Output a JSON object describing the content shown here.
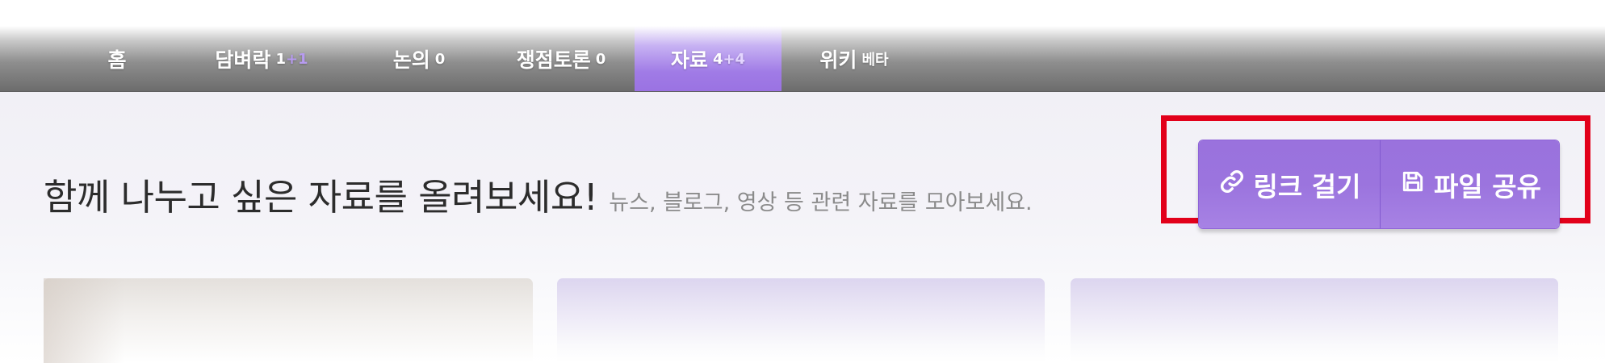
{
  "nav": {
    "tabs": [
      {
        "label": "홈",
        "count": "",
        "plus": "",
        "extra": ""
      },
      {
        "label": "담벼락",
        "count": "1",
        "plus": "+1",
        "extra": ""
      },
      {
        "label": "논의",
        "count": "0",
        "plus": "",
        "extra": ""
      },
      {
        "label": "쟁점토론",
        "count": "0",
        "plus": "",
        "extra": ""
      },
      {
        "label": "자료",
        "count": "4",
        "plus": "+4",
        "extra": ""
      },
      {
        "label": "위키",
        "count": "",
        "plus": "",
        "extra": "베타"
      }
    ],
    "active_tab": "자료"
  },
  "main": {
    "headline": "함께 나누고 싶은 자료를 올려보세요!",
    "subline": "뉴스, 블로그, 영상 등 관련 자료를 모아보세요."
  },
  "actions": {
    "link_label": "링크 걸기",
    "link_icon": "link-icon",
    "file_label": "파일 공유",
    "file_icon": "floppy-disk-icon"
  },
  "colors": {
    "accent": "#9b74de",
    "highlight": "#e2001a"
  }
}
